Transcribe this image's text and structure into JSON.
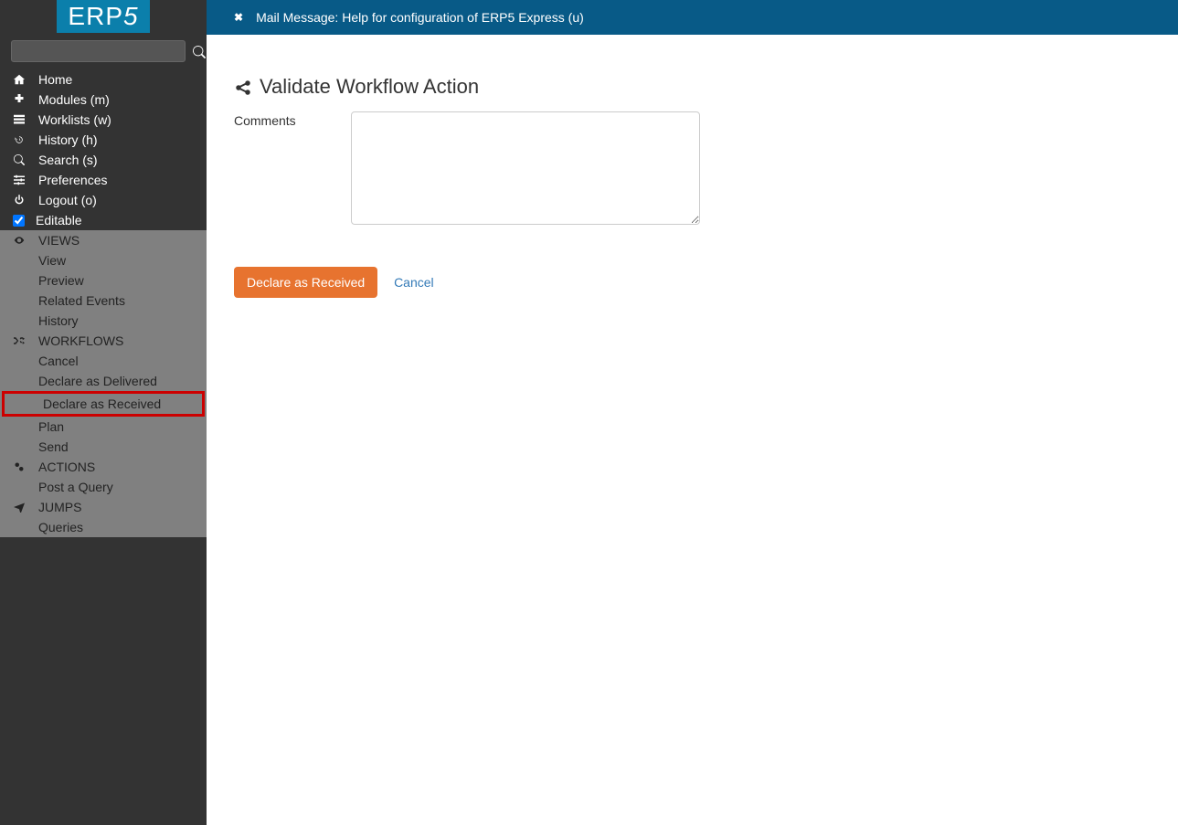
{
  "brand": {
    "name": "ERP",
    "suffix": "5"
  },
  "search": {
    "placeholder": ""
  },
  "nav": {
    "home": "Home",
    "modules": "Modules (m)",
    "worklists": "Worklists (w)",
    "history": "History (h)",
    "search": "Search (s)",
    "preferences": "Preferences",
    "logout": "Logout (o)",
    "editable": "Editable"
  },
  "views": {
    "header": "VIEWS",
    "items": [
      "View",
      "Preview",
      "Related Events",
      "History"
    ]
  },
  "workflows": {
    "header": "WORKFLOWS",
    "items": [
      "Cancel",
      "Declare as Delivered",
      "Declare as Received",
      "Plan",
      "Send"
    ],
    "highlighted_index": 2
  },
  "actions_section": {
    "header": "ACTIONS",
    "items": [
      "Post a Query"
    ]
  },
  "jumps": {
    "header": "JUMPS",
    "items": [
      "Queries"
    ]
  },
  "topbar": {
    "message": "Mail Message: Help for configuration of ERP5 Express (u)"
  },
  "page": {
    "title": "Validate Workflow Action",
    "comments_label": "Comments",
    "comments_value": ""
  },
  "buttons": {
    "primary": "Declare as Received",
    "cancel": "Cancel"
  }
}
